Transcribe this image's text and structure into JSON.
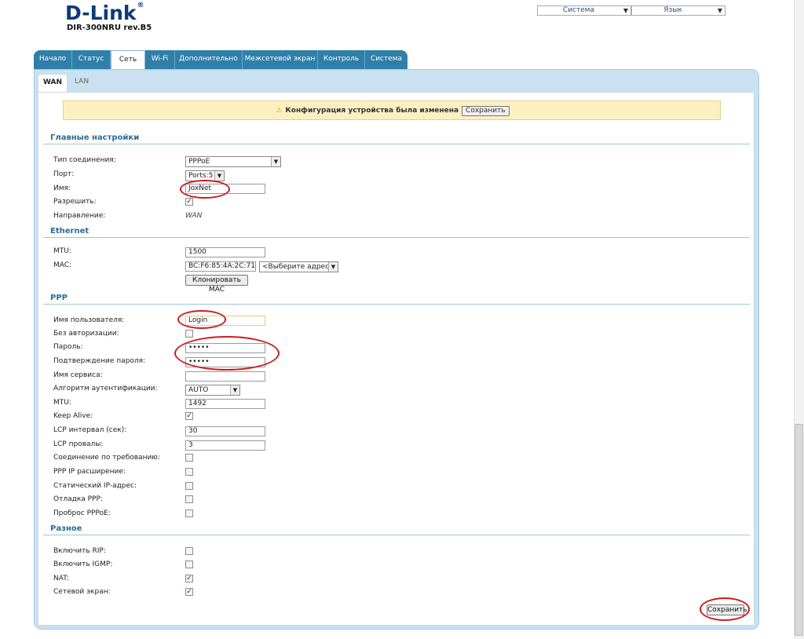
{
  "header": {
    "logo": "D-Link",
    "logo_mark": "®",
    "model": "DIR-300NRU rev.B5",
    "system_select": "Система",
    "language_select": "Язык"
  },
  "tabs": [
    "Начало",
    "Статус",
    "Сеть",
    "Wi-Fi",
    "Дополнительно",
    "Межсетевой экран",
    "Контроль",
    "Система"
  ],
  "active_tab": "Сеть",
  "subtabs": [
    "WAN",
    "LAN"
  ],
  "notice": {
    "text": "Конфигурация устройства была изменена",
    "button": "Сохранить"
  },
  "main": {
    "title": "Главные настройки",
    "connection_type_label": "Тип соединения:",
    "connection_type": "PPPoE",
    "port_label": "Порт:",
    "port": "Ports:5",
    "name_label": "Имя:",
    "name": "JoxNet",
    "enable_label": "Разрешить:",
    "enable": true,
    "direction_label": "Направление:",
    "direction": "WAN"
  },
  "ethernet": {
    "title": "Ethernet",
    "mtu_label": "MTU:",
    "mtu": "1500",
    "mac_label": "MAC:",
    "mac": "BC:F6:85:4A:2C:71",
    "mac_select": "<Выберите адрес>",
    "clone_button": "Клонировать MAC"
  },
  "ppp": {
    "title": "PPP",
    "username_label": "Имя пользователя:",
    "username": "Login",
    "no_auth_label": "Без авторизации:",
    "password_label": "Пароль:",
    "password": "•••••",
    "confirm_label": "Подтверждение пароля:",
    "confirm": "•••••",
    "service_label": "Имя сервиса:",
    "auth_algo_label": "Алгоритм аутентификации:",
    "auth_algo": "AUTO",
    "mtu_label": "MTU:",
    "mtu": "1492",
    "keepalive_label": "Keep Alive:",
    "lcp_interval_label": "LCP интервал (сек):",
    "lcp_interval": "30",
    "lcp_fails_label": "LCP провалы:",
    "lcp_fails": "3",
    "on_demand_label": "Соединение по требованию:",
    "ip_ext_label": "PPP IP расширение:",
    "static_ip_label": "Статический IP-адрес:",
    "debug_label": "Отладка PPP:",
    "pppoe_pass_label": "Проброс PPPoE:"
  },
  "misc": {
    "title": "Разное",
    "rip_label": "Включить RIP:",
    "igmp_label": "Включить IGMP:",
    "nat_label": "NAT:",
    "firewall_label": "Сетевой экран:"
  },
  "save_button": "Сохранить",
  "checkmark": "✓",
  "colors": {
    "tab_bar": "#2f7fa9",
    "section_title": "#2a6c96",
    "annotation_oval": "#cc1e1e",
    "notice_bg": "#fbf0c1"
  }
}
